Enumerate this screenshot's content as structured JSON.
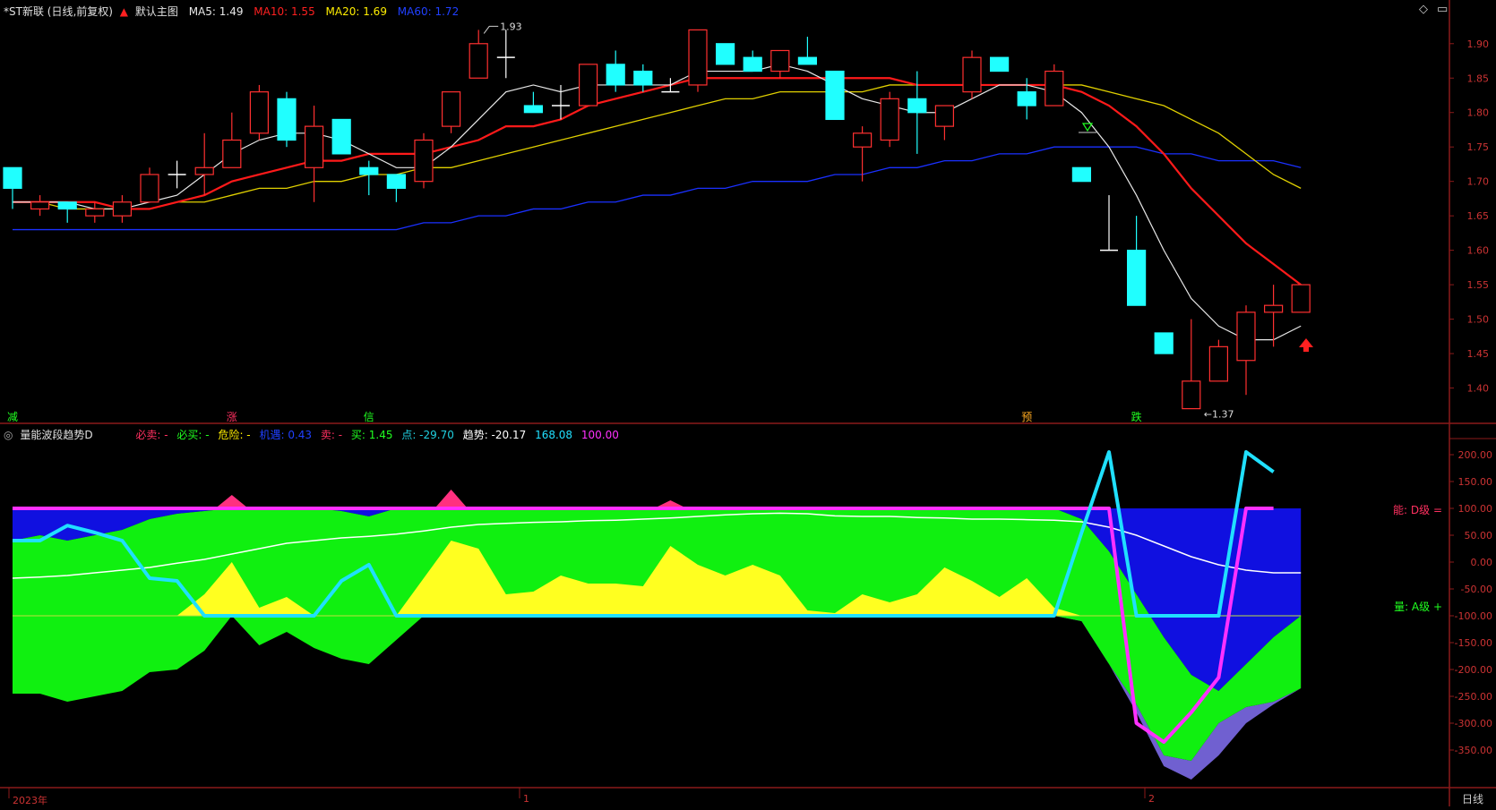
{
  "upper_header": {
    "title": "*ST新联 (日线,前复权)",
    "template": "默认主图",
    "ma": [
      {
        "label": "MA5: 1.49",
        "color": "#e8e8e8"
      },
      {
        "label": "MA10: 1.55",
        "color": "#ff2020"
      },
      {
        "label": "MA20: 1.69",
        "color": "#ffee00"
      },
      {
        "label": "MA60: 1.72",
        "color": "#2040ff"
      }
    ]
  },
  "lower_header": {
    "title": "量能波段趋势D",
    "items": [
      {
        "label": "必卖: -",
        "color": "#ff3060"
      },
      {
        "label": "必买: -",
        "color": "#20ff20"
      },
      {
        "label": "危险: -",
        "color": "#ffee00"
      },
      {
        "label": "机遇: 0.43",
        "color": "#2040ff"
      },
      {
        "label": "卖: -",
        "color": "#ff3060"
      },
      {
        "label": "买: 1.45",
        "color": "#20ff20"
      },
      {
        "label": "点: -29.70",
        "color": "#20d0e0"
      },
      {
        "label": "趋势: -20.17",
        "color": "#ffffff"
      },
      {
        "label": "168.08",
        "color": "#20e0ff"
      },
      {
        "label": "100.00",
        "color": "#ff30ff"
      }
    ]
  },
  "signals": [
    {
      "text": "减",
      "color": "#20ff20",
      "index": 0
    },
    {
      "text": "涨",
      "color": "#ff3060",
      "index": 8
    },
    {
      "text": "信",
      "color": "#20ff20",
      "index": 13
    },
    {
      "text": "预",
      "color": "#ffaa20",
      "index": 37
    },
    {
      "text": "跌",
      "color": "#20ff20",
      "index": 41
    }
  ],
  "labels": {
    "high_marker": "1.93",
    "low_marker": "1.37",
    "right_label_top": "能: D级 =",
    "right_label_bottom": "量: A级 +",
    "time_axis": [
      "2023年",
      "1",
      "2"
    ],
    "period": "日线"
  },
  "icons": {
    "up_arrow": "red-up-arrow-icon",
    "settings": "diamond-icon",
    "window": "window-icon"
  },
  "chart_data": [
    {
      "type": "candlestick",
      "title": "*ST新联 (日线,前复权)",
      "ylim": [
        1.35,
        1.94
      ],
      "yticks": [
        1.4,
        1.45,
        1.5,
        1.55,
        1.6,
        1.65,
        1.7,
        1.75,
        1.8,
        1.85,
        1.9
      ],
      "candles": [
        {
          "o": 1.72,
          "h": 1.72,
          "l": 1.66,
          "c": 1.69
        },
        {
          "o": 1.66,
          "h": 1.68,
          "l": 1.65,
          "c": 1.67
        },
        {
          "o": 1.67,
          "h": 1.67,
          "l": 1.64,
          "c": 1.66
        },
        {
          "o": 1.65,
          "h": 1.67,
          "l": 1.64,
          "c": 1.66
        },
        {
          "o": 1.65,
          "h": 1.68,
          "l": 1.64,
          "c": 1.67
        },
        {
          "o": 1.67,
          "h": 1.72,
          "l": 1.67,
          "c": 1.71
        },
        {
          "o": 1.71,
          "h": 1.73,
          "l": 1.69,
          "c": 1.71
        },
        {
          "o": 1.71,
          "h": 1.77,
          "l": 1.68,
          "c": 1.72
        },
        {
          "o": 1.72,
          "h": 1.8,
          "l": 1.72,
          "c": 1.76
        },
        {
          "o": 1.77,
          "h": 1.84,
          "l": 1.76,
          "c": 1.83
        },
        {
          "o": 1.82,
          "h": 1.83,
          "l": 1.75,
          "c": 1.76
        },
        {
          "o": 1.72,
          "h": 1.81,
          "l": 1.67,
          "c": 1.78
        },
        {
          "o": 1.79,
          "h": 1.79,
          "l": 1.74,
          "c": 1.74
        },
        {
          "o": 1.72,
          "h": 1.73,
          "l": 1.68,
          "c": 1.71
        },
        {
          "o": 1.71,
          "h": 1.71,
          "l": 1.67,
          "c": 1.69
        },
        {
          "o": 1.7,
          "h": 1.77,
          "l": 1.69,
          "c": 1.76
        },
        {
          "o": 1.78,
          "h": 1.83,
          "l": 1.77,
          "c": 1.83
        },
        {
          "o": 1.85,
          "h": 1.92,
          "l": 1.85,
          "c": 1.9
        },
        {
          "o": 1.88,
          "h": 1.92,
          "l": 1.85,
          "c": 1.88
        },
        {
          "o": 1.81,
          "h": 1.83,
          "l": 1.81,
          "c": 1.8
        },
        {
          "o": 1.81,
          "h": 1.84,
          "l": 1.79,
          "c": 1.81
        },
        {
          "o": 1.81,
          "h": 1.87,
          "l": 1.81,
          "c": 1.87
        },
        {
          "o": 1.87,
          "h": 1.89,
          "l": 1.83,
          "c": 1.84
        },
        {
          "o": 1.86,
          "h": 1.87,
          "l": 1.83,
          "c": 1.84
        },
        {
          "o": 1.83,
          "h": 1.85,
          "l": 1.83,
          "c": 1.83
        },
        {
          "o": 1.84,
          "h": 1.92,
          "l": 1.83,
          "c": 1.92
        },
        {
          "o": 1.9,
          "h": 1.9,
          "l": 1.87,
          "c": 1.87
        },
        {
          "o": 1.88,
          "h": 1.89,
          "l": 1.86,
          "c": 1.86
        },
        {
          "o": 1.86,
          "h": 1.89,
          "l": 1.85,
          "c": 1.89
        },
        {
          "o": 1.88,
          "h": 1.91,
          "l": 1.87,
          "c": 1.87
        },
        {
          "o": 1.86,
          "h": 1.86,
          "l": 1.79,
          "c": 1.79
        },
        {
          "o": 1.75,
          "h": 1.78,
          "l": 1.7,
          "c": 1.77
        },
        {
          "o": 1.76,
          "h": 1.83,
          "l": 1.75,
          "c": 1.82
        },
        {
          "o": 1.82,
          "h": 1.86,
          "l": 1.74,
          "c": 1.8
        },
        {
          "o": 1.78,
          "h": 1.81,
          "l": 1.76,
          "c": 1.81
        },
        {
          "o": 1.83,
          "h": 1.89,
          "l": 1.82,
          "c": 1.88
        },
        {
          "o": 1.88,
          "h": 1.88,
          "l": 1.86,
          "c": 1.86
        },
        {
          "o": 1.83,
          "h": 1.85,
          "l": 1.79,
          "c": 1.81
        },
        {
          "o": 1.81,
          "h": 1.87,
          "l": 1.81,
          "c": 1.86
        },
        {
          "o": 1.72,
          "h": 1.72,
          "l": 1.7,
          "c": 1.7
        },
        {
          "o": 1.6,
          "h": 1.68,
          "l": 1.6,
          "c": 1.6
        },
        {
          "o": 1.6,
          "h": 1.65,
          "l": 1.52,
          "c": 1.52
        },
        {
          "o": 1.48,
          "h": 1.48,
          "l": 1.45,
          "c": 1.45
        },
        {
          "o": 1.37,
          "h": 1.5,
          "l": 1.37,
          "c": 1.41
        },
        {
          "o": 1.41,
          "h": 1.47,
          "l": 1.41,
          "c": 1.46
        },
        {
          "o": 1.44,
          "h": 1.52,
          "l": 1.39,
          "c": 1.51
        },
        {
          "o": 1.51,
          "h": 1.55,
          "l": 1.46,
          "c": 1.52
        },
        {
          "o": 1.51,
          "h": 1.55,
          "l": 1.51,
          "c": 1.55
        }
      ],
      "ma5": [
        1.67,
        1.67,
        1.67,
        1.66,
        1.66,
        1.67,
        1.68,
        1.71,
        1.74,
        1.76,
        1.77,
        1.77,
        1.76,
        1.74,
        1.72,
        1.72,
        1.75,
        1.79,
        1.83,
        1.84,
        1.83,
        1.84,
        1.84,
        1.84,
        1.84,
        1.86,
        1.86,
        1.86,
        1.87,
        1.86,
        1.84,
        1.82,
        1.81,
        1.8,
        1.8,
        1.82,
        1.84,
        1.84,
        1.83,
        1.8,
        1.75,
        1.68,
        1.6,
        1.53,
        1.49,
        1.47,
        1.47,
        1.49
      ],
      "ma10": [
        1.67,
        1.67,
        1.67,
        1.67,
        1.66,
        1.66,
        1.67,
        1.68,
        1.7,
        1.71,
        1.72,
        1.73,
        1.73,
        1.74,
        1.74,
        1.74,
        1.75,
        1.76,
        1.78,
        1.78,
        1.79,
        1.81,
        1.82,
        1.83,
        1.84,
        1.85,
        1.85,
        1.85,
        1.85,
        1.85,
        1.85,
        1.85,
        1.85,
        1.84,
        1.84,
        1.84,
        1.84,
        1.84,
        1.84,
        1.83,
        1.81,
        1.78,
        1.74,
        1.69,
        1.65,
        1.61,
        1.58,
        1.55
      ],
      "ma20": [
        1.67,
        1.67,
        1.66,
        1.66,
        1.66,
        1.66,
        1.67,
        1.67,
        1.68,
        1.69,
        1.69,
        1.7,
        1.7,
        1.71,
        1.71,
        1.72,
        1.72,
        1.73,
        1.74,
        1.75,
        1.76,
        1.77,
        1.78,
        1.79,
        1.8,
        1.81,
        1.82,
        1.82,
        1.83,
        1.83,
        1.83,
        1.83,
        1.84,
        1.84,
        1.84,
        1.84,
        1.84,
        1.84,
        1.84,
        1.84,
        1.83,
        1.82,
        1.81,
        1.79,
        1.77,
        1.74,
        1.71,
        1.69
      ],
      "ma60": [
        1.63,
        1.63,
        1.63,
        1.63,
        1.63,
        1.63,
        1.63,
        1.63,
        1.63,
        1.63,
        1.63,
        1.63,
        1.63,
        1.63,
        1.63,
        1.64,
        1.64,
        1.65,
        1.65,
        1.66,
        1.66,
        1.67,
        1.67,
        1.68,
        1.68,
        1.69,
        1.69,
        1.7,
        1.7,
        1.7,
        1.71,
        1.71,
        1.72,
        1.72,
        1.73,
        1.73,
        1.74,
        1.74,
        1.75,
        1.75,
        1.75,
        1.75,
        1.74,
        1.74,
        1.73,
        1.73,
        1.73,
        1.72
      ]
    },
    {
      "type": "area",
      "title": "量能波段趋势D",
      "ylim": [
        -420,
        230
      ],
      "yticks": [
        200,
        150,
        100,
        50,
        0,
        -50,
        -100,
        -150,
        -200,
        -250,
        -300,
        -350
      ],
      "band_top": [
        100,
        100,
        100,
        100,
        100,
        100,
        100,
        100,
        100,
        100,
        100,
        100,
        100,
        100,
        100,
        100,
        100,
        100,
        100,
        100,
        100,
        100,
        100,
        100,
        100,
        100,
        100,
        100,
        100,
        100,
        100,
        100,
        100,
        100,
        100,
        100,
        100,
        100,
        100,
        100,
        100,
        100,
        100,
        100,
        100,
        100,
        100,
        100
      ],
      "green_top": [
        40,
        50,
        40,
        50,
        60,
        80,
        90,
        95,
        100,
        100,
        100,
        100,
        95,
        85,
        100,
        100,
        100,
        100,
        100,
        100,
        100,
        100,
        100,
        100,
        100,
        100,
        100,
        100,
        100,
        100,
        100,
        100,
        100,
        100,
        100,
        100,
        100,
        100,
        100,
        80,
        20,
        -60,
        -140,
        -210,
        -240,
        -190,
        -140,
        -100
      ],
      "green_bottom": [
        -245,
        -245,
        -260,
        -250,
        -240,
        -205,
        -200,
        -165,
        -100,
        -155,
        -130,
        -160,
        -180,
        -190,
        -145,
        -100,
        -100,
        -100,
        -100,
        -100,
        -100,
        -100,
        -100,
        -100,
        -100,
        -100,
        -100,
        -100,
        -100,
        -100,
        -100,
        -100,
        -100,
        -100,
        -100,
        -100,
        -100,
        -100,
        -100,
        -110,
        -190,
        -265,
        -360,
        -370,
        -300,
        -270,
        -260,
        -235
      ],
      "yellow": [
        -100,
        -100,
        -100,
        -100,
        -100,
        -100,
        -100,
        -60,
        0,
        -85,
        -65,
        -100,
        -100,
        -100,
        -100,
        -30,
        40,
        25,
        -60,
        -55,
        -25,
        -40,
        -40,
        -45,
        30,
        -5,
        -25,
        -5,
        -25,
        -90,
        -95,
        -60,
        -75,
        -60,
        -10,
        -35,
        -65,
        -30,
        -85,
        -100,
        -100,
        -100,
        -100,
        -100,
        -100,
        -100,
        -100,
        -100
      ],
      "purple_bottom": [
        null,
        null,
        null,
        null,
        null,
        null,
        null,
        null,
        null,
        null,
        null,
        null,
        null,
        null,
        null,
        null,
        null,
        null,
        null,
        null,
        null,
        null,
        null,
        null,
        null,
        null,
        null,
        null,
        null,
        -90,
        -95,
        -75,
        -85,
        -75,
        -20,
        -45,
        -75,
        -40,
        -90,
        -100,
        -190,
        -280,
        -380,
        -405,
        -360,
        -300,
        -265,
        -235
      ],
      "trend_white": [
        -30,
        -28,
        -25,
        -20,
        -15,
        -10,
        -2,
        5,
        15,
        25,
        35,
        40,
        45,
        48,
        52,
        58,
        65,
        70,
        72,
        74,
        75,
        77,
        78,
        80,
        82,
        85,
        88,
        90,
        91,
        90,
        86,
        85,
        85,
        83,
        82,
        80,
        80,
        79,
        78,
        75,
        65,
        50,
        30,
        10,
        -5,
        -15,
        -20,
        -20
      ],
      "cyan_point": [
        40,
        40,
        68,
        55,
        40,
        -30,
        -35,
        -100,
        -100,
        -100,
        -100,
        -100,
        -35,
        -5,
        -100,
        -100,
        -100,
        -100,
        -100,
        -100,
        -100,
        -100,
        -100,
        -100,
        -100,
        -100,
        -100,
        -100,
        -100,
        -100,
        -100,
        -100,
        -100,
        -100,
        -100,
        -100,
        -100,
        -100,
        -100,
        55,
        205,
        -100,
        -100,
        -100,
        -100,
        205,
        168
      ],
      "magenta": [
        100,
        100,
        100,
        100,
        100,
        100,
        100,
        100,
        100,
        100,
        100,
        100,
        100,
        100,
        100,
        100,
        100,
        100,
        100,
        100,
        100,
        100,
        100,
        100,
        100,
        100,
        100,
        100,
        100,
        100,
        100,
        100,
        100,
        100,
        100,
        100,
        100,
        100,
        100,
        100,
        100,
        -300,
        -335,
        -280,
        -215,
        100,
        100
      ],
      "pink_peaks": [
        {
          "index": 8,
          "value": 125
        },
        {
          "index": 16,
          "value": 135
        },
        {
          "index": 24,
          "value": 115
        }
      ]
    }
  ]
}
